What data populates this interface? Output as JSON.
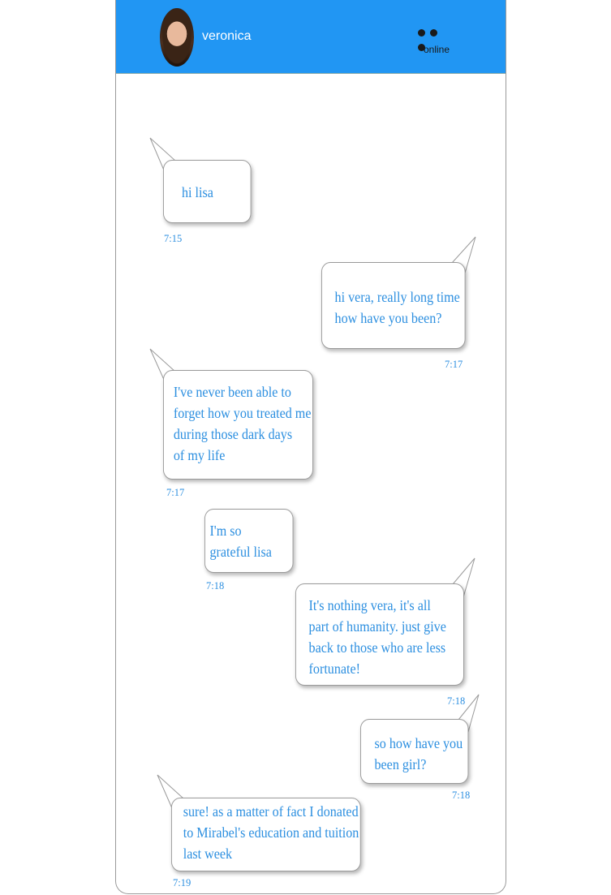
{
  "header": {
    "contact_name": "veronica",
    "status": "online",
    "avatar": "profile-photo",
    "menu_icon": "more-dots-icon",
    "background_color": "#2196f3"
  },
  "messages": [
    {
      "direction": "incoming",
      "text": "hi lisa",
      "time": "7:15"
    },
    {
      "direction": "outgoing",
      "text": "hi vera, really long time\nhow have you been?",
      "time": "7:17"
    },
    {
      "direction": "incoming",
      "text": "I've never been able to\nforget how you treated me\nduring those dark days\nof my life",
      "time": "7:17"
    },
    {
      "direction": "incoming",
      "text": "I'm so\ngrateful lisa",
      "time": "7:18"
    },
    {
      "direction": "outgoing",
      "text": "It's nothing vera, it's all\npart of humanity. just give\nback to those who are less\nfortunate!",
      "time": "7:18"
    },
    {
      "direction": "outgoing",
      "text": "so how have you\nbeen girl?",
      "time": "7:18"
    },
    {
      "direction": "incoming",
      "text": "sure! as a matter of fact I donated\nto Mirabel's education and tuition\nlast week",
      "time": "7:19"
    }
  ],
  "colors": {
    "text": "#2c8fe0",
    "bubble_border": "#9a9a9a"
  }
}
